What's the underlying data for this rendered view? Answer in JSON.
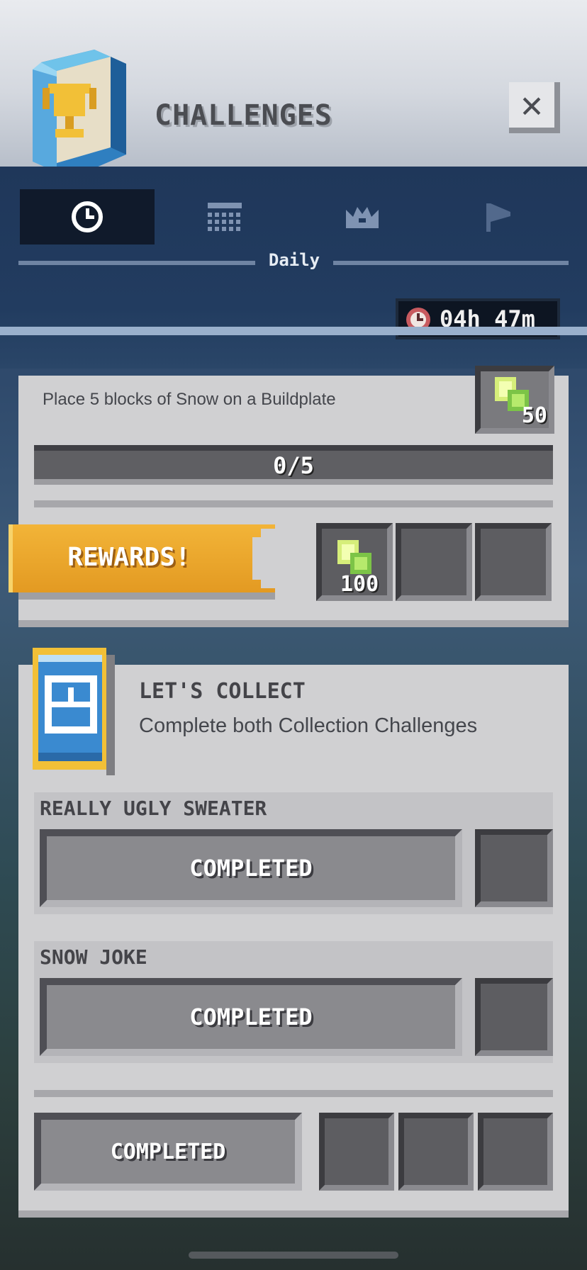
{
  "header": {
    "title": "CHALLENGES",
    "close_icon": "close-icon"
  },
  "nav": {
    "tabs": [
      {
        "icon": "clock-icon",
        "active": true
      },
      {
        "icon": "calendar-icon",
        "active": false
      },
      {
        "icon": "crown-icon",
        "active": false
      },
      {
        "icon": "flag-icon",
        "active": false
      }
    ],
    "current_tab_label": "Daily",
    "timer": "04h 47m"
  },
  "snow_card": {
    "description": "Place 5 blocks of Snow on a Buildplate",
    "reward_amount": "50",
    "progress_text": "0/5",
    "progress": 0.0,
    "rewards_label": "REWARDS!",
    "reward_slots": [
      "100",
      "",
      ""
    ]
  },
  "collect_card": {
    "title": "LET'S COLLECT",
    "description": "Complete both Collection Challenges",
    "sub_challenges": [
      {
        "title": "REALLY UGLY SWEATER",
        "status": "COMPLETED"
      },
      {
        "title": "SNOW JOKE",
        "status": "COMPLETED"
      }
    ],
    "footer_status": "COMPLETED"
  },
  "colors": {
    "accent_gold": "#e9a52c",
    "rubies_green": "#b7e36a"
  }
}
